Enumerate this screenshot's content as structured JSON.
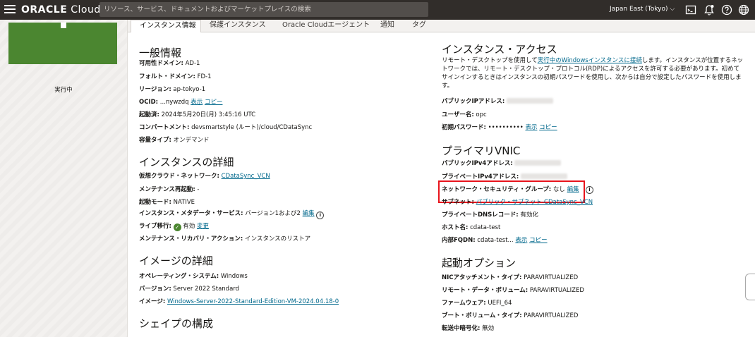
{
  "header": {
    "brand_oracle": "ORACLE",
    "brand_cloud": " Cloud",
    "search_placeholder": "リソース、サービス、ドキュメントおよびマーケットプレイスの検索",
    "region": "Japan East (Tokyo)"
  },
  "left_panel": {
    "state": "実行中"
  },
  "tabs": [
    {
      "label": "インスタンス情報",
      "active": true
    },
    {
      "label": "保護インスタンス"
    },
    {
      "label": "Oracle Cloudエージェント"
    },
    {
      "label": "通知"
    },
    {
      "label": "タグ"
    }
  ],
  "general": {
    "title": "一般情報",
    "ad_label": "可用性ドメイン:",
    "ad_value": " AD-1",
    "fd_label": "フォルト・ドメイン:",
    "fd_value": " FD-1",
    "region_label": "リージョン:",
    "region_value": " ap-tokyo-1",
    "ocid_label": "OCID:",
    "ocid_value": " ...nywzdq ",
    "ocid_show": "表示",
    "ocid_copy": "コピー",
    "launched_label": "起動済:",
    "launched_value": " 2024年5月20日(月) 3:45:16 UTC",
    "compartment_label": "コンパートメント:",
    "compartment_value": " devsmartstyle (ルート)/cloud/CDataSync",
    "capacity_label": "容量タイプ:",
    "capacity_value": " オンデマンド"
  },
  "details": {
    "title": "インスタンスの詳細",
    "vcn_label": "仮想クラウド・ネットワーク:",
    "vcn_value": "CDataSync_VCN",
    "maint_label": "メンテナンス再起動:",
    "maint_value": " -",
    "launch_mode_label": "起動モード:",
    "launch_mode_value": " NATIVE",
    "metadata_label": "インスタンス・メタデータ・サービス:",
    "metadata_value": " バージョン1および2 ",
    "metadata_edit": "編集",
    "live_mig_label": "ライブ移行:",
    "live_mig_value": " 有効 ",
    "live_mig_change": "変更",
    "recovery_label": "メンテナンス・リカバリ・アクション:",
    "recovery_value": " インスタンスのリストア"
  },
  "image": {
    "title": "イメージの詳細",
    "os_label": "オペレーティング・システム:",
    "os_value": " Windows",
    "version_label": "バージョン:",
    "version_value": " Server 2022 Standard",
    "image_label": "イメージ:",
    "image_value": "Windows-Server-2022-Standard-Edition-VM-2024.04.18-0"
  },
  "shape": {
    "title": "シェイプの構成"
  },
  "access": {
    "title": "インスタンス・アクセス",
    "desc_1": "リモート・デスクトップを使用して",
    "desc_link": "実行中のWindowsインスタンスに接続",
    "desc_2": "します。インスタンスが位置するネットワークでは、リモート・デスクトップ・プロトコル(RDP)によるアクセスを許可する必要があります。初めてサインインするときはインスタンスの初期パスワードを使用し、次からは自分で設定したパスワードを使用します。",
    "public_ip_label": "パブリックIPアドレス:",
    "user_label": "ユーザー名:",
    "user_value": " opc",
    "pwd_label": "初期パスワード:",
    "pwd_value": " •••••••••• ",
    "pwd_show": "表示",
    "pwd_copy": "コピー"
  },
  "vnic": {
    "title": "プライマリVNIC",
    "public_ipv4_label": "パブリックIPv4アドレス:",
    "private_ipv4_label": "プライベートIPv4アドレス:",
    "nsg_label": "ネットワーク・セキュリティ・グループ:",
    "nsg_value": " なし ",
    "nsg_edit": "編集",
    "subnet_label": "サブネット:",
    "subnet_value": "パブリック・サブネット-CDataSync_VCN",
    "dns_label": "プライベートDNSレコード:",
    "dns_value": " 有効化",
    "host_label": "ホスト名:",
    "host_value": " cdata-test",
    "fqdn_label": "内部FQDN:",
    "fqdn_value": " cdata-test... ",
    "fqdn_show": "表示",
    "fqdn_copy": "コピー"
  },
  "launch": {
    "title": "起動オプション",
    "nic_label": "NICアタッチメント・タイプ:",
    "nic_value": " PARAVIRTUALIZED",
    "remote_vol_label": "リモート・データ・ボリューム:",
    "remote_vol_value": " PARAVIRTUALIZED",
    "firmware_label": "ファームウェア:",
    "firmware_value": " UEFI_64",
    "boot_vol_label": "ブート・ボリューム・タイプ:",
    "boot_vol_value": " PARAVIRTUALIZED",
    "encrypt_label": "転送中暗号化:",
    "encrypt_value": " 無効"
  },
  "colors": {
    "topbar": "#312d2a",
    "running": "#4b8630",
    "link": "#00688c",
    "highlight": "#e8141c"
  }
}
